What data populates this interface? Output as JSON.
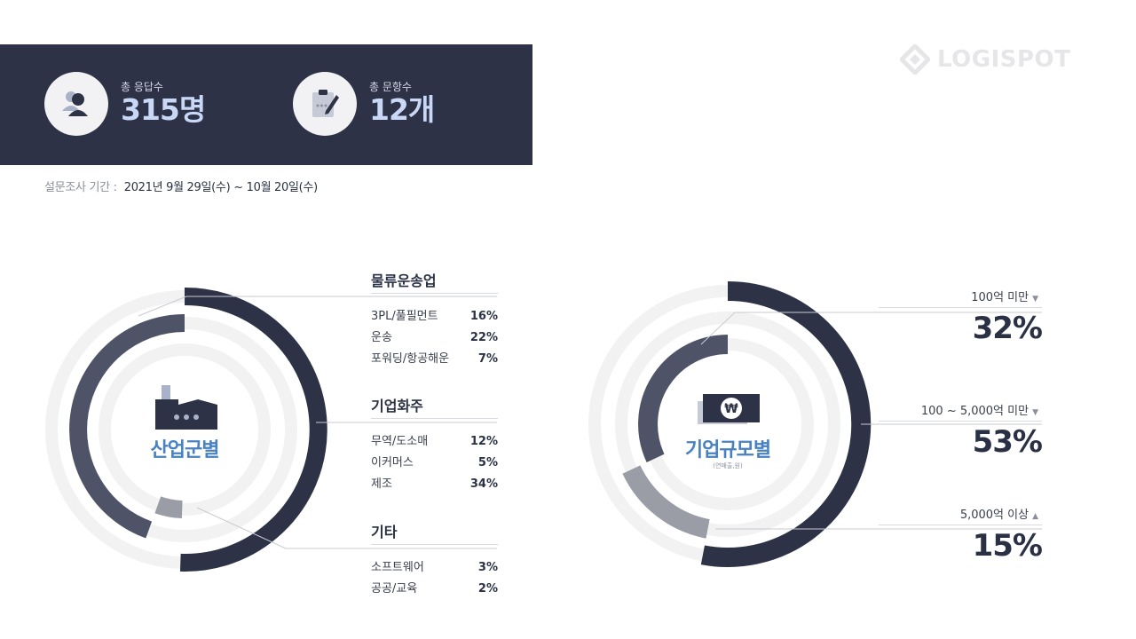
{
  "summary": {
    "respondents": {
      "label": "총 응답수",
      "value": "315명",
      "icon": "person-icon"
    },
    "questions": {
      "label": "총 문항수",
      "value": "12개",
      "icon": "clipboard-pen-icon"
    }
  },
  "period": {
    "label": "설문조사 기간 :",
    "value": "2021년 9월 29일(수) ~ 10월 20일(수)"
  },
  "logo": {
    "text": "LOGISPOT",
    "icon": "diamond-logo-icon"
  },
  "industry": {
    "center_label": "산업군별",
    "icon": "factory-icon",
    "groups": [
      {
        "title": "물류운송업",
        "items": [
          {
            "name": "3PL/풀필먼트",
            "value": "16%"
          },
          {
            "name": "운송",
            "value": "22%"
          },
          {
            "name": "포워딩/항공해운",
            "value": "7%"
          }
        ]
      },
      {
        "title": "기업화주",
        "items": [
          {
            "name": "무역/도소매",
            "value": "12%"
          },
          {
            "name": "이커머스",
            "value": "5%"
          },
          {
            "name": "제조",
            "value": "34%"
          }
        ]
      },
      {
        "title": "기타",
        "items": [
          {
            "name": "소프트웨어",
            "value": "3%"
          },
          {
            "name": "공공/교육",
            "value": "2%"
          }
        ]
      }
    ]
  },
  "company_size": {
    "center_label": "기업규모별",
    "center_sub": "(연매출,원)",
    "icon": "won-bill-icon",
    "items": [
      {
        "label": "100억 미만",
        "value": "32%",
        "arrow": "▼"
      },
      {
        "label": "100 ~ 5,000억 미만",
        "value": "53%",
        "arrow": "▼"
      },
      {
        "label": "5,000억 이상",
        "value": "15%",
        "arrow": "▲"
      }
    ]
  },
  "chart_data": [
    {
      "type": "pie",
      "title": "산업군별",
      "categories": [
        "물류운송업",
        "기업화주",
        "기타"
      ],
      "values": [
        45,
        51,
        5
      ],
      "colors": {
        "물류운송업": "#4f5367",
        "기업화주": "#2d3246",
        "기타": "#9a9ca6"
      }
    },
    {
      "type": "pie",
      "title": "기업규모별",
      "categories": [
        "100억 미만",
        "100 ~ 5,000억 미만",
        "5,000억 이상"
      ],
      "values": [
        32,
        53,
        15
      ],
      "colors": {
        "100억 미만": "#4f5367",
        "100 ~ 5,000억 미만": "#2d3246",
        "5,000억 이상": "#9a9ca6"
      }
    }
  ]
}
